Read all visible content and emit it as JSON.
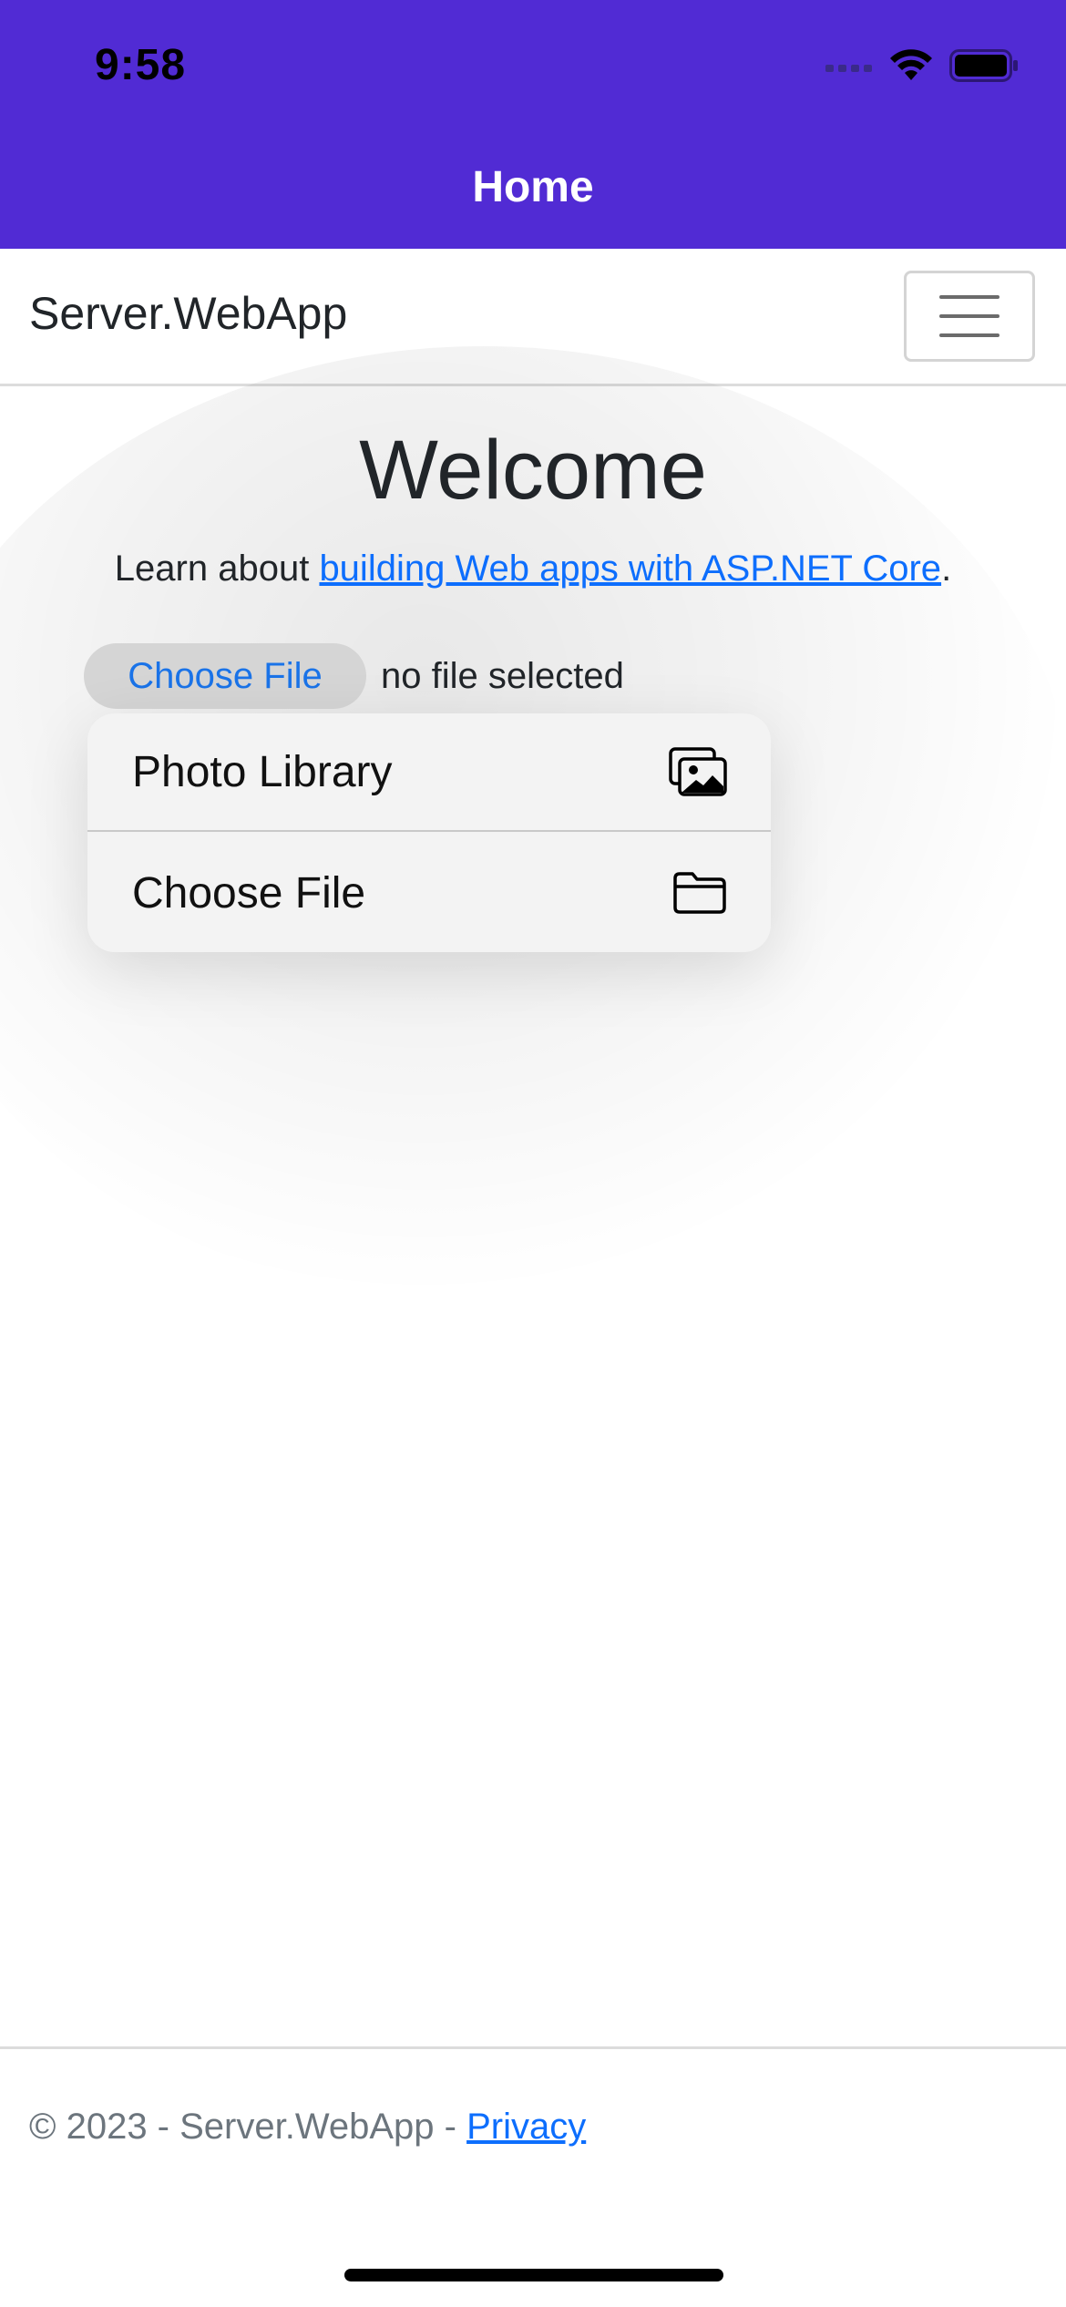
{
  "status_bar": {
    "time": "9:58"
  },
  "app_header": {
    "title": "Home",
    "color": "#512BD4"
  },
  "navbar": {
    "brand": "Server.WebApp"
  },
  "content": {
    "heading": "Welcome",
    "learn_prefix": "Learn about ",
    "learn_link": "building Web apps with ASP.NET Core",
    "learn_suffix": "."
  },
  "file_input": {
    "button_label": "Choose File",
    "status": "no file selected"
  },
  "menu": {
    "items": [
      {
        "label": "Photo Library",
        "icon": "photo-library-icon"
      },
      {
        "label": "Choose File",
        "icon": "folder-icon"
      }
    ]
  },
  "footer": {
    "text": "© 2023 - Server.WebApp - ",
    "link": "Privacy"
  },
  "colors": {
    "accent": "#512BD4",
    "link": "#0d6efd"
  }
}
